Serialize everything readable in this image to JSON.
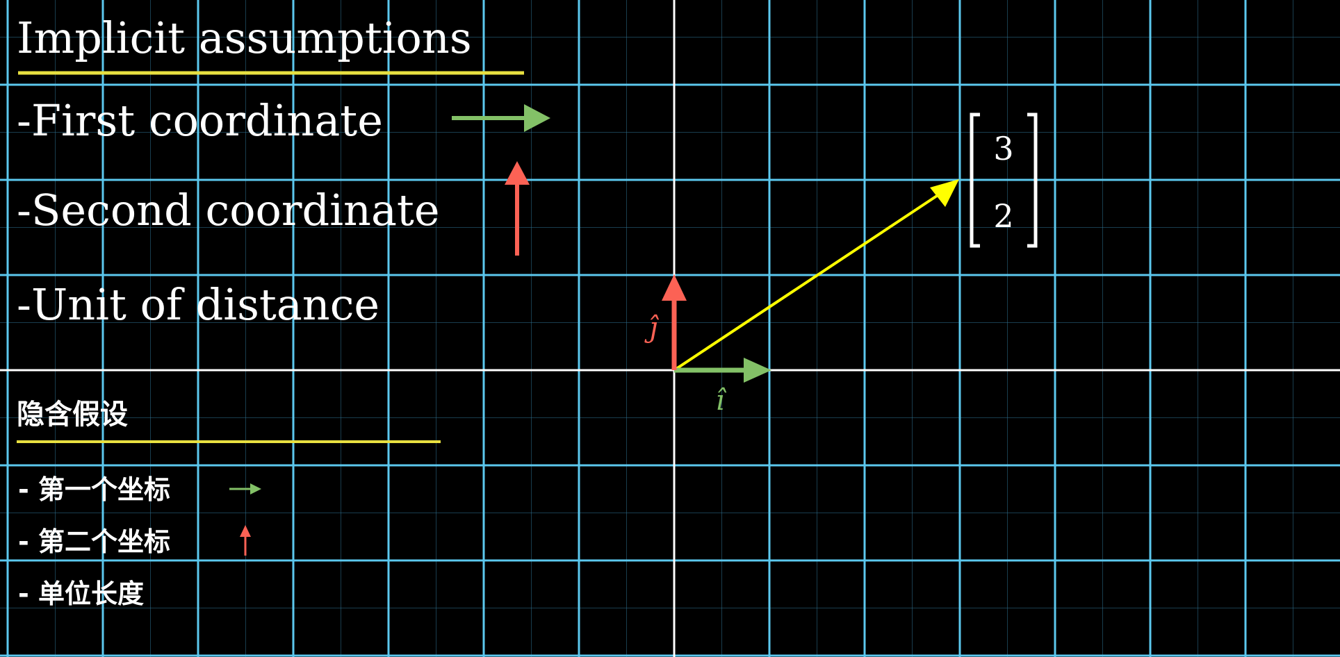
{
  "title": "Implicit assumptions",
  "items": [
    "-First coordinate",
    "-Second coordinate",
    "-Unit of distance"
  ],
  "subtitle_cn": "隐含假设",
  "items_cn": [
    "- 第一个坐标",
    "- 第二个坐标",
    "- 单位长度"
  ],
  "vector": {
    "x": 3,
    "y": 2
  },
  "matrix": {
    "top": "3",
    "bottom": "2"
  },
  "basis_labels": {
    "i_hat": "î",
    "j_hat": "ĵ"
  },
  "colors": {
    "i_hat": "#83c167",
    "j_hat": "#fc6255",
    "vector": "#ffff00",
    "underline": "#e8e040",
    "grid": "#5cc8ee",
    "axis": "#ffffff"
  }
}
